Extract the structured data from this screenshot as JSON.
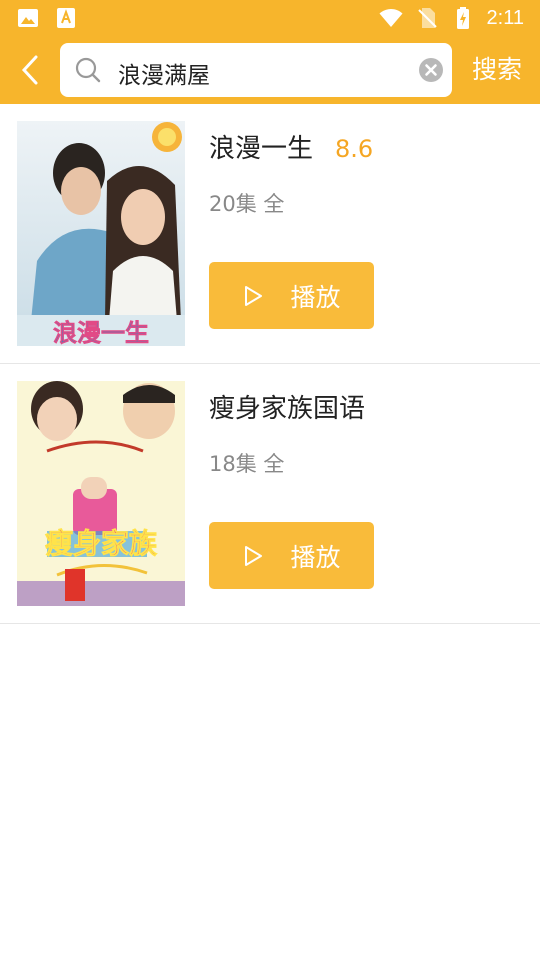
{
  "status_bar": {
    "time": "2:11",
    "icons": [
      "image-icon",
      "font-download-icon",
      "wifi-icon",
      "no-sim-icon",
      "battery-charging-icon"
    ]
  },
  "search": {
    "query": "浪漫满屋",
    "button_label": "搜索",
    "icons": [
      "back-chevron-icon",
      "search-icon",
      "clear-icon"
    ]
  },
  "results": [
    {
      "title": "浪漫一生",
      "score": "8.6",
      "episodes": "20集 全",
      "play_label": "播放",
      "poster_text": "浪漫一生"
    },
    {
      "title": "瘦身家族国语",
      "score": "",
      "episodes": "18集 全",
      "play_label": "播放",
      "poster_text": "瘦身家族"
    }
  ],
  "colors": {
    "accent": "#f7b52c",
    "button": "#f9bb3a",
    "score": "#f5a623",
    "title": "#222222",
    "meta": "#888888"
  }
}
